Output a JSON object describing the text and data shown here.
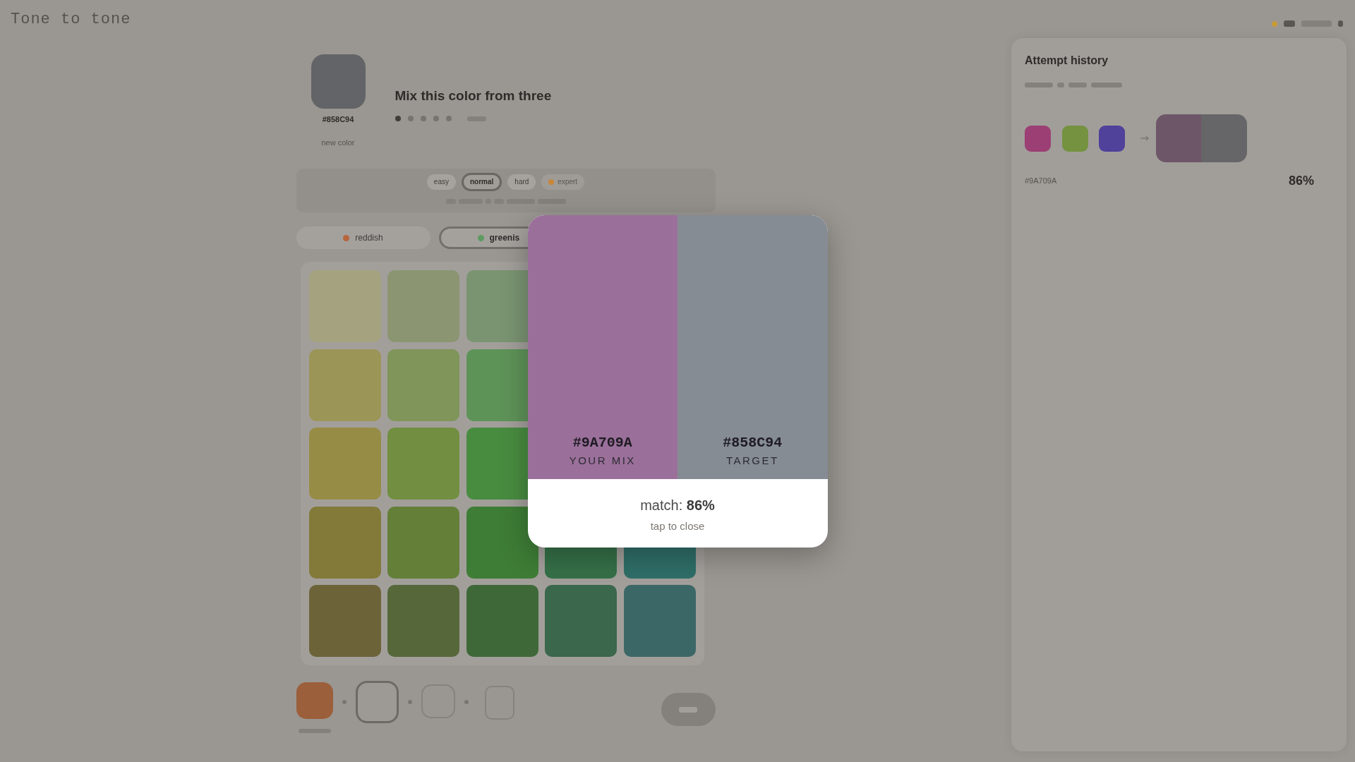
{
  "app": {
    "title": "Tone to tone"
  },
  "target": {
    "color": "#636467",
    "hex": "#858C94",
    "caption": "new color"
  },
  "challenge": {
    "title": "Mix this color from three",
    "rounds": [
      {
        "done": true
      },
      {
        "done": false
      },
      {
        "done": false
      },
      {
        "done": false
      },
      {
        "done": false
      }
    ]
  },
  "difficulty": {
    "levels": [
      {
        "label": "easy",
        "selected": false,
        "locked": false
      },
      {
        "label": "normal",
        "selected": true,
        "locked": false
      },
      {
        "label": "hard",
        "selected": false,
        "locked": false
      },
      {
        "label": "expert",
        "selected": false,
        "locked": true
      }
    ]
  },
  "families": [
    {
      "label": "reddish",
      "color": "#b8653d",
      "selected": false
    },
    {
      "label": "greenis",
      "color": "#5d9a5f",
      "selected": true
    }
  ],
  "palette": {
    "rows": [
      {
        "tiles": [
          {
            "color": "#a5a27f"
          },
          {
            "color": "#8b9572"
          },
          {
            "color": "#7a9472"
          }
        ]
      },
      {
        "tiles": [
          {
            "color": "#9c9558"
          },
          {
            "color": "#7f9559"
          },
          {
            "color": "#5e9358"
          }
        ]
      },
      {
        "tiles": [
          {
            "color": "#978c45"
          },
          {
            "color": "#728e40"
          },
          {
            "color": "#488c40"
          }
        ]
      },
      {
        "tiles": [
          {
            "color": "#837a3a"
          },
          {
            "color": "#637f38"
          },
          {
            "color": "#3e7d36"
          },
          {
            "color": "#357048"
          },
          {
            "color": "#2f6e68"
          }
        ]
      },
      {
        "tiles": [
          {
            "color": "#6c6339"
          },
          {
            "color": "#56683a"
          },
          {
            "color": "#3f6839"
          },
          {
            "color": "#3b674c"
          },
          {
            "color": "#3b6866"
          }
        ]
      }
    ]
  },
  "mixer": {
    "items": [
      {
        "kind": "swatch",
        "color": "#9c5f3b",
        "selected": false
      },
      {
        "kind": "separator"
      },
      {
        "kind": "swatch",
        "selected": true
      },
      {
        "kind": "separator"
      },
      {
        "kind": "swatch",
        "selected": false
      },
      {
        "kind": "separator"
      },
      {
        "kind": "result"
      }
    ]
  },
  "history": {
    "title": "Attempt history",
    "attempts": [
      {
        "picks": [
          {
            "color": "#9b3f74"
          },
          {
            "color": "#74923f"
          },
          {
            "color": "#50419a"
          }
        ],
        "halves": [
          {
            "color": "#6e5669"
          },
          {
            "color": "#666669"
          }
        ],
        "hex": "#9A709A",
        "score": "86%"
      }
    ]
  },
  "dialog": {
    "panels": [
      {
        "color": "#9a709a",
        "hex": "#9A709A",
        "label": "YOUR MIX"
      },
      {
        "color": "#858c94",
        "hex": "#858C94",
        "label": "TARGET"
      }
    ],
    "result": "match: **86%**",
    "hint": "tap to close"
  }
}
